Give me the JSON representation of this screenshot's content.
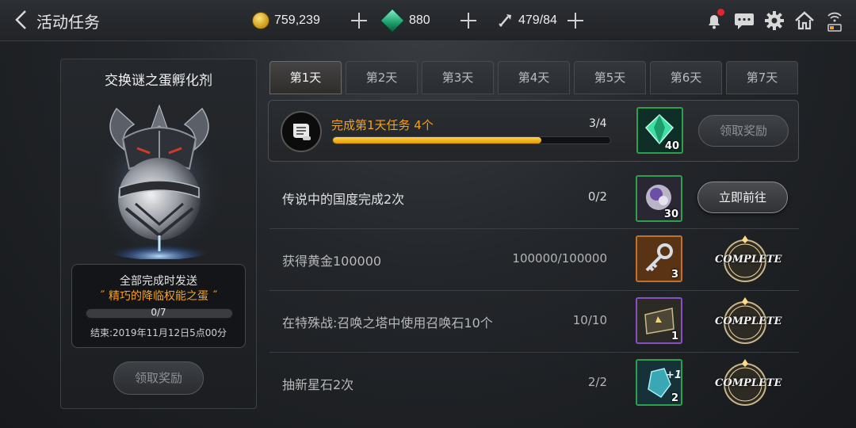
{
  "header": {
    "title": "活动任务",
    "gold": "759,239",
    "gems": "880",
    "stamina": "479/84"
  },
  "left_panel": {
    "title": "交换谜之蛋孵化剂",
    "reward_caption": "全部完成时发送",
    "reward_item": "˝ 精巧的降临权能之蛋 ˝",
    "progress_text": "0/7",
    "progress": 0,
    "end_time": "结束:2019年11月12日5点00分",
    "claim_label": "领取奖励"
  },
  "tabs": [
    {
      "label": "第1天",
      "active": true
    },
    {
      "label": "第2天",
      "active": false
    },
    {
      "label": "第3天",
      "active": false
    },
    {
      "label": "第4天",
      "active": false
    },
    {
      "label": "第5天",
      "active": false
    },
    {
      "label": "第6天",
      "active": false
    },
    {
      "label": "第7天",
      "active": false
    }
  ],
  "main_task": {
    "text": "完成第1天任务  4个",
    "count": "3/4",
    "progress": 0.75,
    "reward_qty": "40",
    "claim_label": "领取奖励"
  },
  "tasks": [
    {
      "name": "传说中的国度完成2次",
      "progress": "0/2",
      "reward_qty": "30",
      "action": "立即前往",
      "complete": false
    },
    {
      "name": "获得黄金100000",
      "progress": "100000/100000",
      "reward_qty": "3",
      "action": "COMPLETE",
      "complete": true
    },
    {
      "name": "在特殊战:召唤之塔中使用召唤石10个",
      "progress": "10/10",
      "reward_qty": "1",
      "action": "COMPLETE",
      "complete": true
    },
    {
      "name": "抽新星石2次",
      "progress": "2/2",
      "reward_qty": "2",
      "action": "COMPLETE",
      "complete": true
    }
  ],
  "colors": {
    "accent_orange": "#f3a21f",
    "rarity_green": "#2da04d",
    "progress_yellow": "#ffc21a"
  }
}
